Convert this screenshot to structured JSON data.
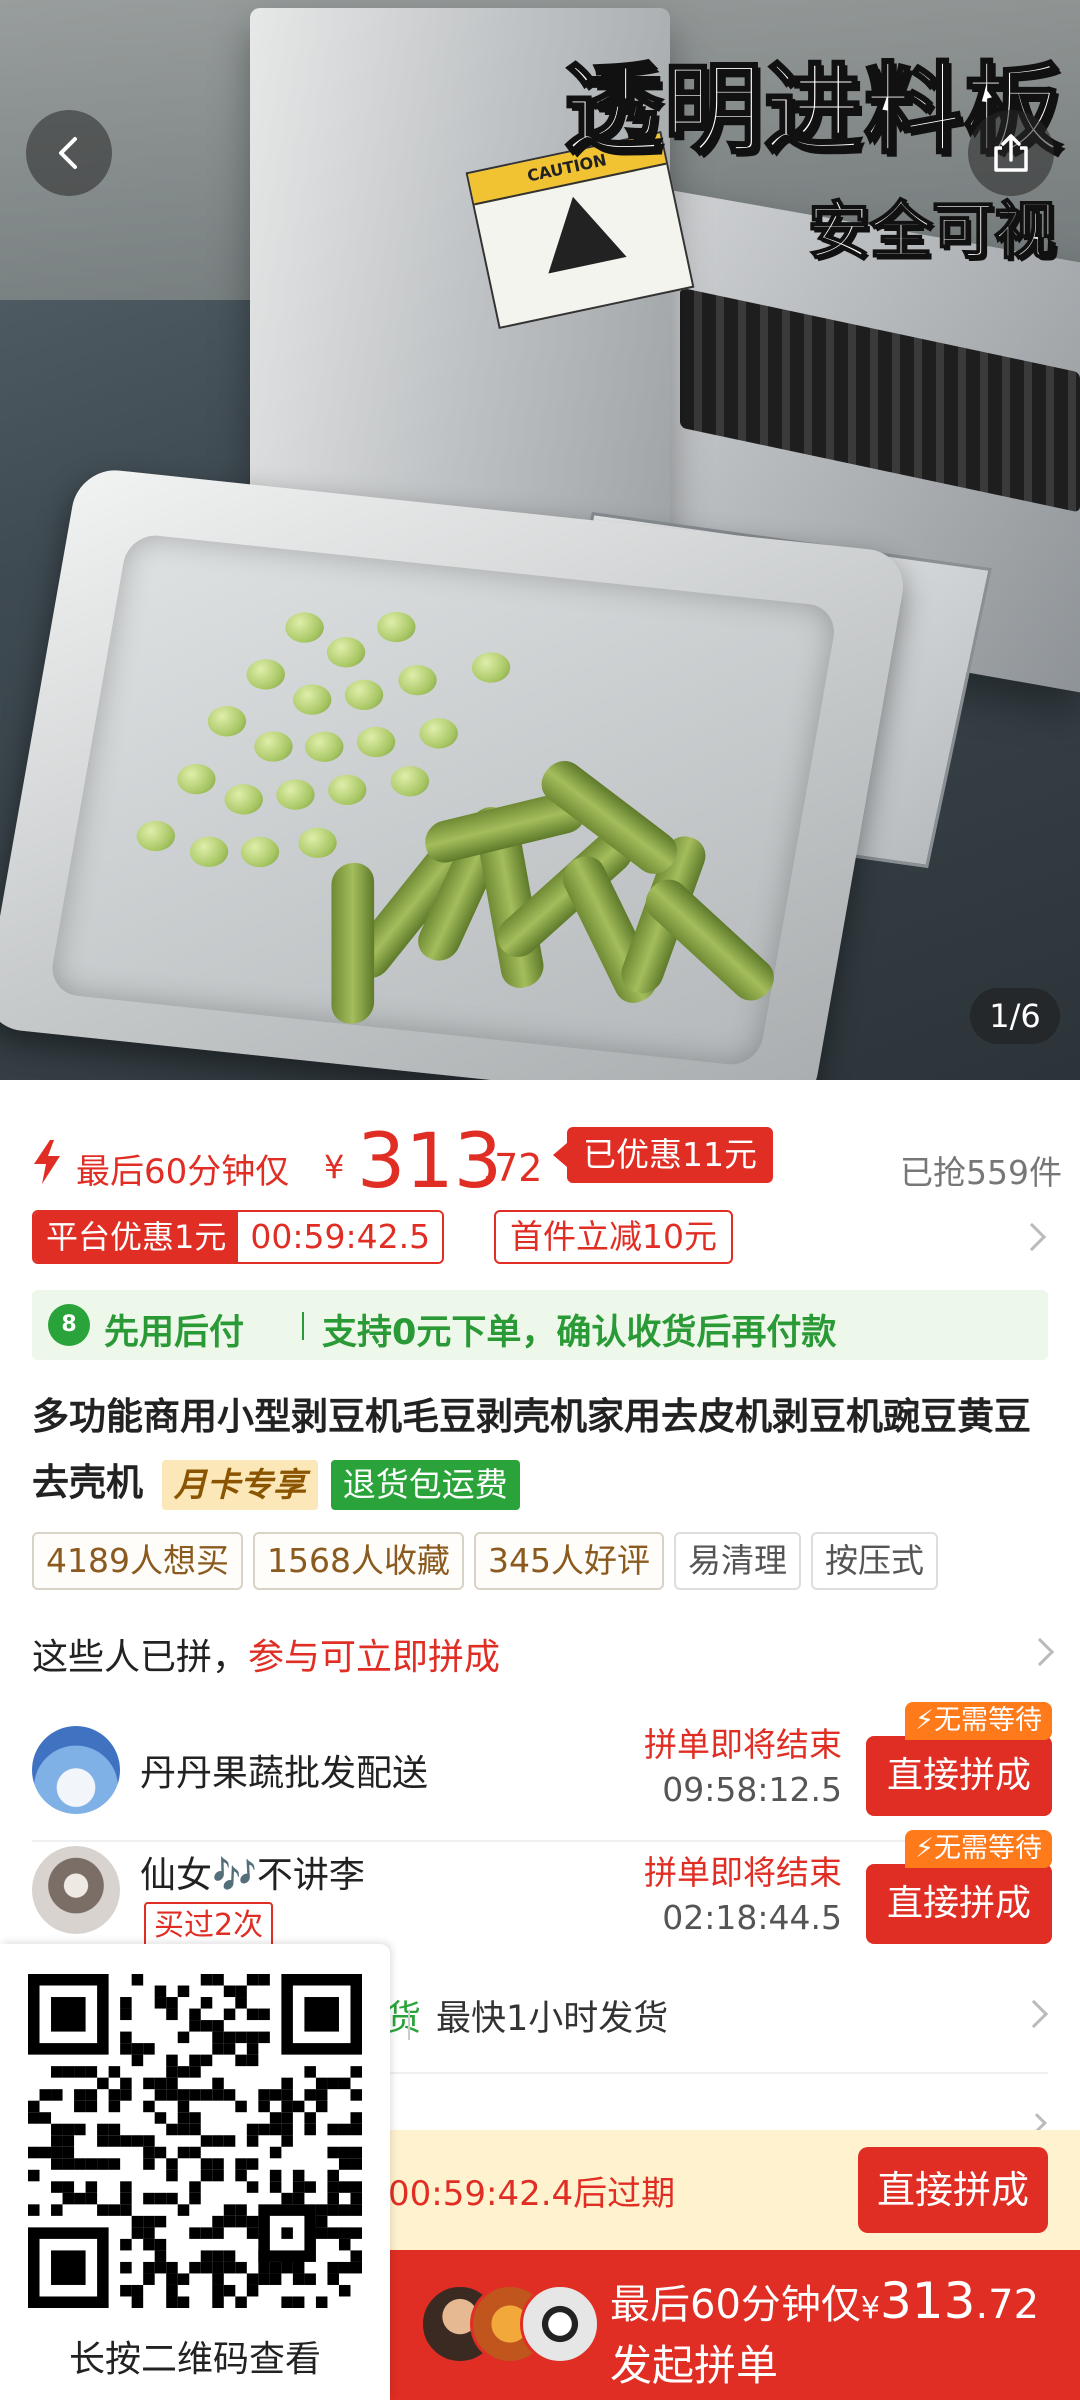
{
  "hero": {
    "headline": "透明进料板",
    "subheadline": "安全可视",
    "sign_label": "CAUTION",
    "counter": "1/6"
  },
  "price": {
    "prefix": "最后60分钟仅",
    "currency": "¥",
    "integer": "313",
    "decimal": ".72",
    "discount_tag": "已优惠11元",
    "sold": "已抢559件"
  },
  "coupons": {
    "platform_label": "平台优惠1元",
    "timer": "00:59:42.5",
    "first_item": "首件立减10元"
  },
  "paylater": {
    "icon_char": "8",
    "title": "先用后付",
    "text": "支持0元下单，确认收货后再付款"
  },
  "product": {
    "title": "多功能商用小型剥豆机毛豆剥壳机家用去皮机剥豆机豌豆黄豆去壳机",
    "tag_monthly": "月卡专享",
    "tag_return": "退货包运费"
  },
  "chips": [
    "4189人想买",
    "1568人收藏",
    "345人好评",
    "易清理",
    "按压式"
  ],
  "groups": {
    "header_plain": "这些人已拼，",
    "header_highlight": "参与可立即拼成",
    "items": [
      {
        "name": "丹丹果蔬批发配送",
        "status": "拼单即将结束",
        "time": "09:58:12.5",
        "button": "直接拼成",
        "flag": "无需等待"
      },
      {
        "name": "仙女🎶不讲李",
        "badge": "买过2次",
        "status": "拼单即将结束",
        "time": "02:18:44.5",
        "button": "直接拼成",
        "flag": "无需等待"
      }
    ]
  },
  "shipping": {
    "partial": "货",
    "text": "最快1小时发货"
  },
  "bottom": {
    "expire": "00:59:42.4后过期",
    "direct_button": "直接拼成",
    "launch_prefix": "最后60分钟仅",
    "launch_currency": "¥",
    "launch_int": "313",
    "launch_dec": ".72",
    "launch_label": "发起拼单"
  },
  "qr": {
    "caption": "长按二维码查看"
  },
  "colors": {
    "accent_red": "#e02e24",
    "green": "#2aa33a",
    "orange": "#ff7a1a"
  }
}
